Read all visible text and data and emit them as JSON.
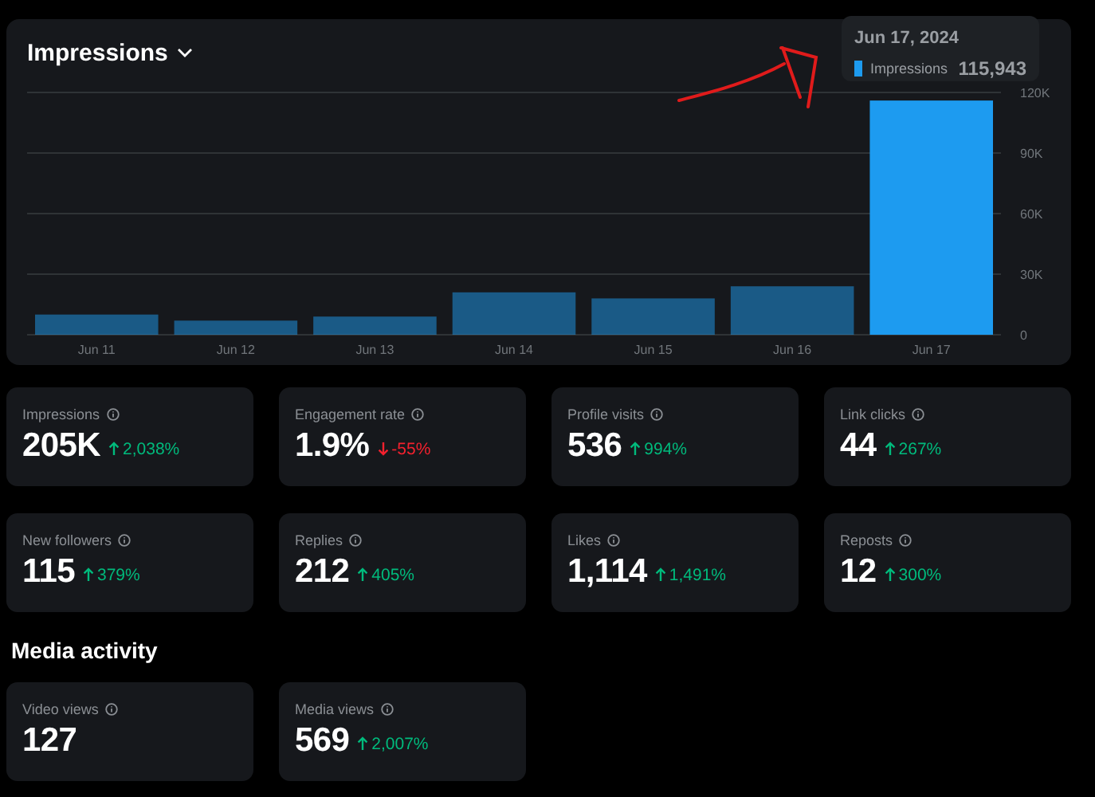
{
  "chart_card": {
    "title": "Impressions",
    "chart_data": {
      "type": "bar",
      "categories": [
        "Jun 11",
        "Jun 12",
        "Jun 13",
        "Jun 14",
        "Jun 15",
        "Jun 16",
        "Jun 17"
      ],
      "series": [
        {
          "name": "Impressions",
          "color": "#1d9bf0",
          "values": [
            10000,
            7000,
            9000,
            21000,
            18000,
            24000,
            116000
          ]
        }
      ],
      "grid": true,
      "ylim": [
        0,
        120000
      ],
      "yticks": [
        {
          "value": 0,
          "label": "0"
        },
        {
          "value": 30000,
          "label": "30K"
        },
        {
          "value": 60000,
          "label": "60K"
        },
        {
          "value": 90000,
          "label": "90K"
        },
        {
          "value": 120000,
          "label": "120K"
        }
      ]
    },
    "bars": [
      {
        "selected": false
      },
      {
        "selected": false
      },
      {
        "selected": false
      },
      {
        "selected": false
      },
      {
        "selected": false
      },
      {
        "selected": false
      },
      {
        "selected": true
      }
    ],
    "tooltip": {
      "date": "Jun 17, 2024",
      "value": "115,943"
    }
  },
  "stats": [
    {
      "label": "Impressions",
      "value": "205K",
      "change": "2,038%",
      "rising": true
    },
    {
      "label": "Engagement rate",
      "value": "1.9%",
      "change": "-55%",
      "rising": false
    },
    {
      "label": "Profile visits",
      "value": "536",
      "change": "994%",
      "rising": true
    },
    {
      "label": "Link clicks",
      "value": "44",
      "change": "267%",
      "rising": true
    },
    {
      "label": "New followers",
      "value": "115",
      "change": "379%",
      "rising": true
    },
    {
      "label": "Replies",
      "value": "212",
      "change": "405%",
      "rising": true
    },
    {
      "label": "Likes",
      "value": "1,114",
      "change": "1,491%",
      "rising": true
    },
    {
      "label": "Reposts",
      "value": "12",
      "change": "300%",
      "rising": true
    }
  ],
  "media_activity": {
    "title": "Media activity",
    "stats": [
      {
        "label": "Video views",
        "value": "127"
      },
      {
        "label": "Media views",
        "value": "569",
        "change": "2,007%",
        "rising": true
      }
    ]
  }
}
